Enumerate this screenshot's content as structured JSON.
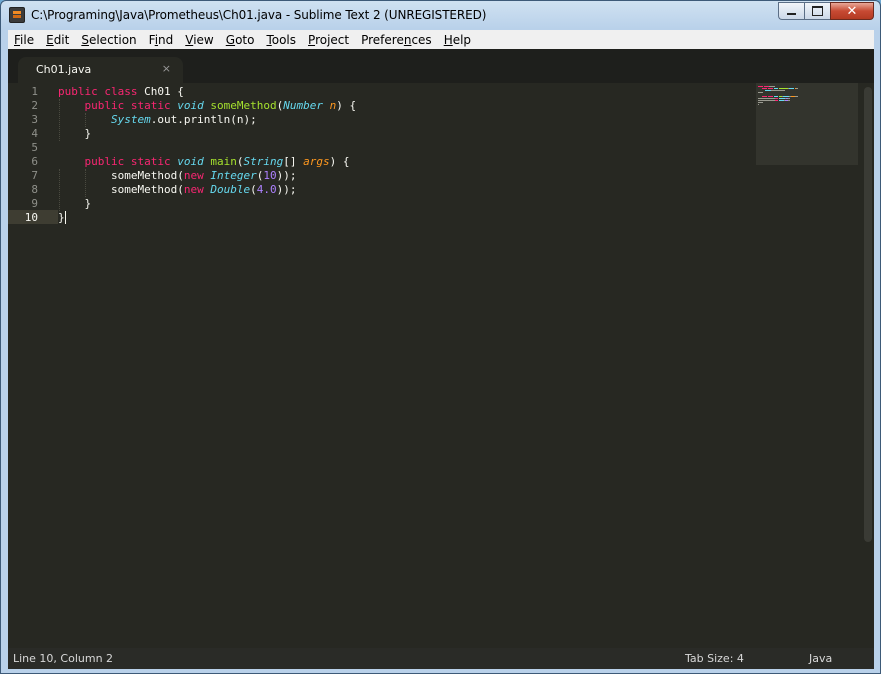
{
  "window": {
    "title": "C:\\Programing\\Java\\Prometheus\\Ch01.java - Sublime Text 2 (UNREGISTERED)"
  },
  "menu": [
    {
      "label": "File",
      "key": "F",
      "rest": "ile"
    },
    {
      "label": "Edit",
      "key": "E",
      "rest": "dit"
    },
    {
      "label": "Selection",
      "key": "S",
      "rest": "election"
    },
    {
      "label": "Find",
      "pre": "F",
      "key": "i",
      "rest": "nd"
    },
    {
      "label": "View",
      "key": "V",
      "rest": "iew"
    },
    {
      "label": "Goto",
      "key": "G",
      "rest": "oto"
    },
    {
      "label": "Tools",
      "key": "T",
      "rest": "ools"
    },
    {
      "label": "Project",
      "key": "P",
      "rest": "roject"
    },
    {
      "label": "Preferences",
      "pre": "Prefere",
      "key": "n",
      "rest": "ces"
    },
    {
      "label": "Help",
      "key": "H",
      "rest": "elp"
    }
  ],
  "tab": {
    "label": "Ch01.java",
    "close": "×"
  },
  "editor": {
    "active_line": 10,
    "lines": [
      {
        "n": "1",
        "tokens": [
          [
            "kw",
            "public"
          ],
          [
            "",
            "",
            " "
          ],
          [
            "kw",
            "class"
          ],
          [
            "",
            "",
            " Ch01 {"
          ]
        ]
      },
      {
        "n": "2",
        "tokens": [
          [
            "",
            "",
            "    "
          ],
          [
            "kw",
            "public"
          ],
          [
            "",
            "",
            " "
          ],
          [
            "kw",
            "static"
          ],
          [
            "",
            "",
            " "
          ],
          [
            "st",
            "void"
          ],
          [
            "",
            "",
            " "
          ],
          [
            "fn",
            "someMethod"
          ],
          [
            "",
            "",
            "("
          ],
          [
            "st",
            "Number"
          ],
          [
            "",
            "",
            " "
          ],
          [
            "pa",
            "n"
          ],
          [
            "",
            "",
            ") {"
          ]
        ]
      },
      {
        "n": "3",
        "tokens": [
          [
            "",
            "",
            "        "
          ],
          [
            "st",
            "System"
          ],
          [
            "",
            "",
            ".out.println(n);"
          ]
        ]
      },
      {
        "n": "4",
        "tokens": [
          [
            "",
            "",
            "    }"
          ]
        ]
      },
      {
        "n": "5",
        "tokens": []
      },
      {
        "n": "6",
        "tokens": [
          [
            "",
            "",
            "    "
          ],
          [
            "kw",
            "public"
          ],
          [
            "",
            "",
            " "
          ],
          [
            "kw",
            "static"
          ],
          [
            "",
            "",
            " "
          ],
          [
            "st",
            "void"
          ],
          [
            "",
            "",
            " "
          ],
          [
            "fn",
            "main"
          ],
          [
            "",
            "",
            "("
          ],
          [
            "st",
            "String"
          ],
          [
            "",
            "",
            "[] "
          ],
          [
            "pa",
            "args"
          ],
          [
            "",
            "",
            ") {"
          ]
        ]
      },
      {
        "n": "7",
        "tokens": [
          [
            "",
            "",
            "        someMethod("
          ],
          [
            "kw",
            "new"
          ],
          [
            "",
            "",
            " "
          ],
          [
            "st",
            "Integer"
          ],
          [
            "",
            "",
            "("
          ],
          [
            "nu",
            "10"
          ],
          [
            "",
            "",
            "));"
          ]
        ]
      },
      {
        "n": "8",
        "tokens": [
          [
            "",
            "",
            "        someMethod("
          ],
          [
            "kw",
            "new"
          ],
          [
            "",
            "",
            " "
          ],
          [
            "st",
            "Double"
          ],
          [
            "",
            "",
            "("
          ],
          [
            "nu",
            "4.0"
          ],
          [
            "",
            "",
            "));"
          ]
        ]
      },
      {
        "n": "9",
        "tokens": [
          [
            "",
            "",
            "    }"
          ]
        ]
      },
      {
        "n": "10",
        "tokens": [
          [
            "",
            "",
            "}"
          ],
          [
            "cursor",
            ""
          ]
        ]
      }
    ]
  },
  "statusbar": {
    "position": "Line 10, Column 2",
    "tab_size": "Tab Size: 4",
    "syntax": "Java"
  },
  "colors": {
    "background": "#272822",
    "keyword": "#f92672",
    "storage_type": "#66d9ef",
    "function": "#a6e22e",
    "parameter": "#fd971f",
    "number": "#ae81ff",
    "text": "#f8f8f2"
  }
}
